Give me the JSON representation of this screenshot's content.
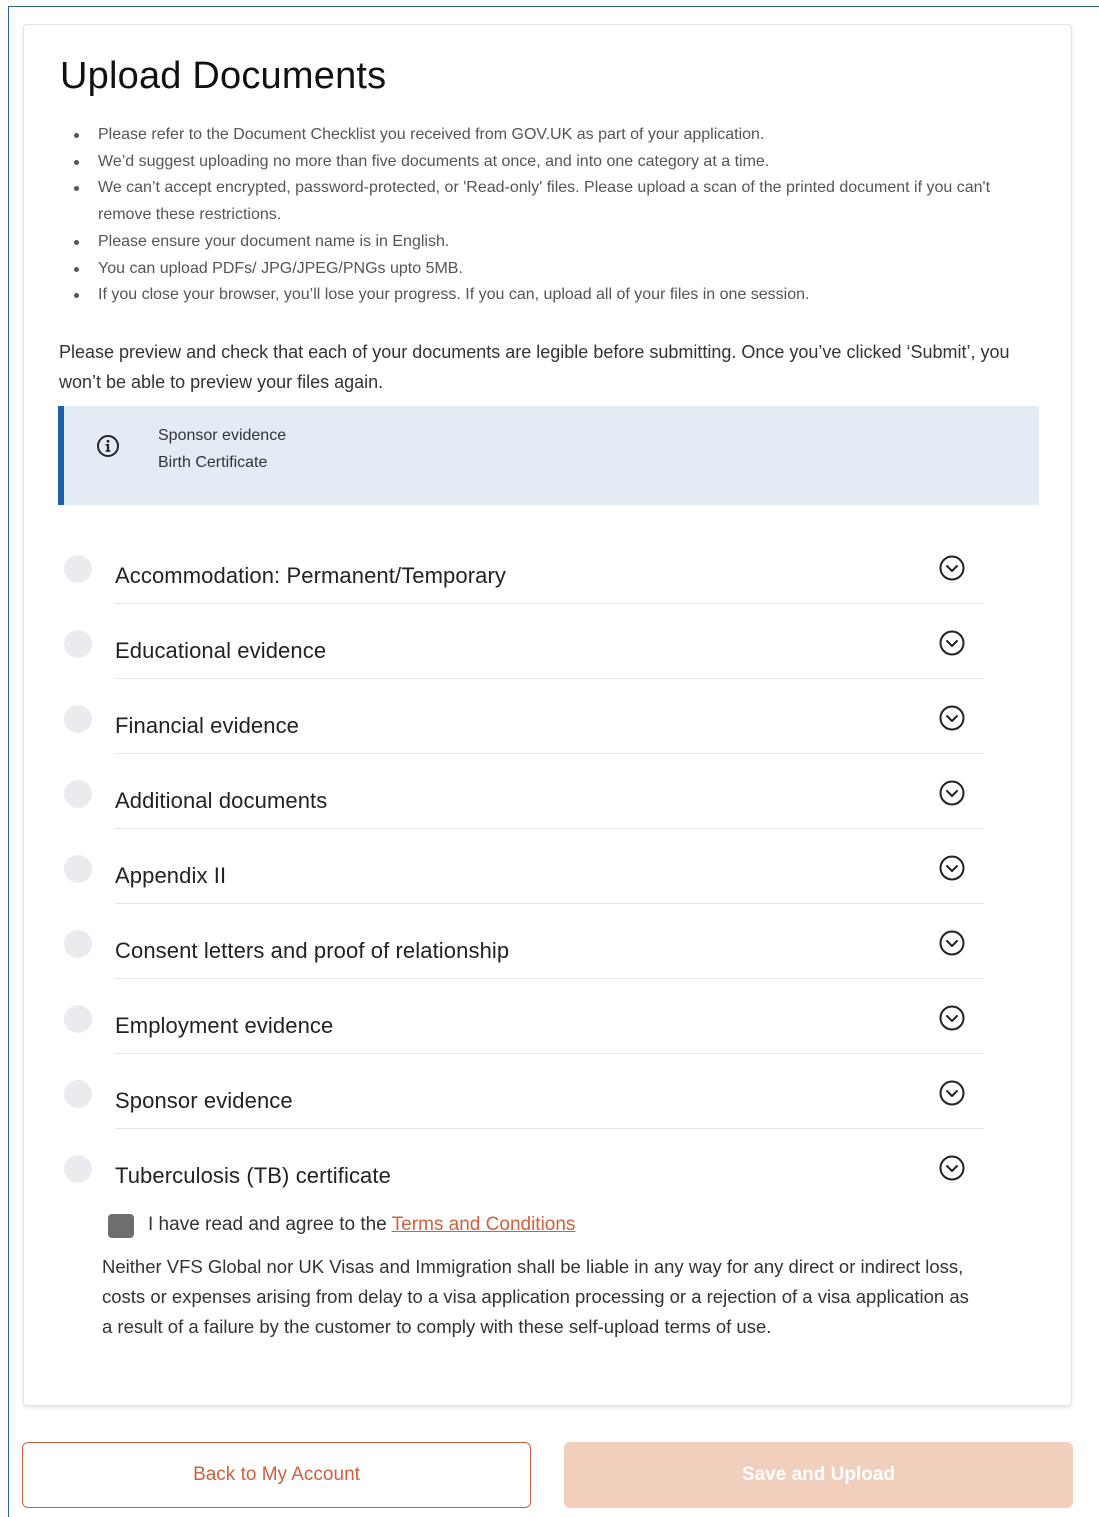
{
  "page": {
    "title": "Upload Documents"
  },
  "notes": [
    "Please refer to the Document Checklist you received from GOV.UK as part of your application.",
    "We’d suggest uploading no more than five documents at once, and into one category at a time.",
    "We can’t accept encrypted, password-protected, or 'Read-only' files. Please upload a scan of the printed document if you can't remove these restrictions.",
    "Please ensure your document name is in English.",
    "You can upload PDFs/ JPG/JPEG/PNGs upto 5MB.",
    "If you close your browser, you’ll lose your progress. If you can, upload all of your files in one session."
  ],
  "preview_text": "Please preview and check that each of your documents are legible before submitting. Once you’ve clicked ‘Submit’, you won’t be able to preview your files again.",
  "info_box": {
    "icon": "info-icon",
    "lines": [
      "Sponsor evidence",
      "Birth Certificate"
    ]
  },
  "categories": [
    "Accommodation: Permanent/Temporary",
    "Educational evidence",
    "Financial evidence",
    "Additional documents",
    "Appendix II",
    "Consent letters and proof of relationship",
    "Employment evidence",
    "Sponsor evidence",
    "Tuberculosis (TB) certificate"
  ],
  "terms": {
    "prefix": "I have read and agree to the",
    "link": "Terms and Conditions"
  },
  "disclaimer": "Neither VFS Global nor UK Visas and Immigration shall be liable in any way for any direct or indirect loss, costs or expenses arising from delay to a visa application processing or a rejection of a visa application as a result of a failure by the customer to comply with these self-upload terms of use.",
  "buttons": {
    "back": "Back to My Account",
    "save": "Save and Upload"
  },
  "colors": {
    "accent": "#d0603e",
    "save_disabled": "#f2cebd",
    "info_bg": "#e3ecf5",
    "info_border": "#1d5fa8"
  }
}
